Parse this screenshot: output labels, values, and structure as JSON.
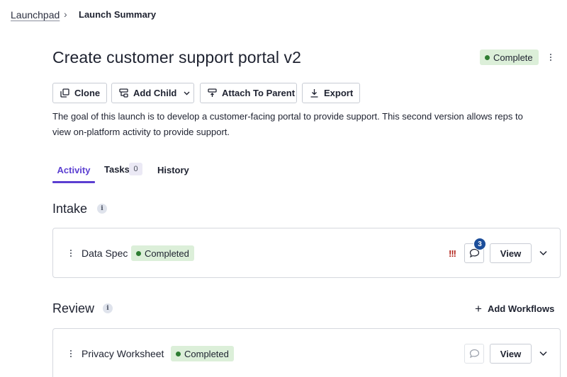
{
  "breadcrumb": {
    "root": "Launchpad",
    "separator": "›",
    "current": "Launch Summary"
  },
  "header": {
    "title": "Create customer support portal v2",
    "status": "Complete"
  },
  "actions": {
    "clone": "Clone",
    "add_child": "Add Child",
    "attach_to_parent": "Attach To Parent",
    "export": "Export"
  },
  "description": "The goal of this launch is to develop a customer-facing portal to provide support. This second version allows reps to view on-platform activity to provide support.",
  "tabs": [
    {
      "label": "Activity",
      "active": true
    },
    {
      "label": "Tasks",
      "count": "0"
    },
    {
      "label": "History"
    }
  ],
  "sections": {
    "intake": {
      "title": "Intake",
      "info_icon": "i",
      "row": {
        "name": "Data Spec",
        "status": "Completed",
        "priority": "!!!",
        "comment_count": "3",
        "view_label": "View"
      }
    },
    "review": {
      "title": "Review",
      "info_icon": "i",
      "add_workflows": "Add Workflows",
      "add_icon": "+",
      "row": {
        "name": "Privacy Worksheet",
        "status": "Completed",
        "view_label": "View"
      }
    }
  },
  "colors": {
    "accent": "#5b3fd1",
    "status_bg": "#dcefd9",
    "status_dot": "#2e7d32",
    "priority": "#b3261e",
    "count_badge": "#1c4e9a"
  },
  "icons": {
    "clone": "clone-icon",
    "add_child": "add-child-icon",
    "attach": "attach-parent-icon",
    "export": "download-icon",
    "comment": "comment-icon",
    "expand": "chevron-down-icon",
    "more": "kebab-menu-icon"
  }
}
